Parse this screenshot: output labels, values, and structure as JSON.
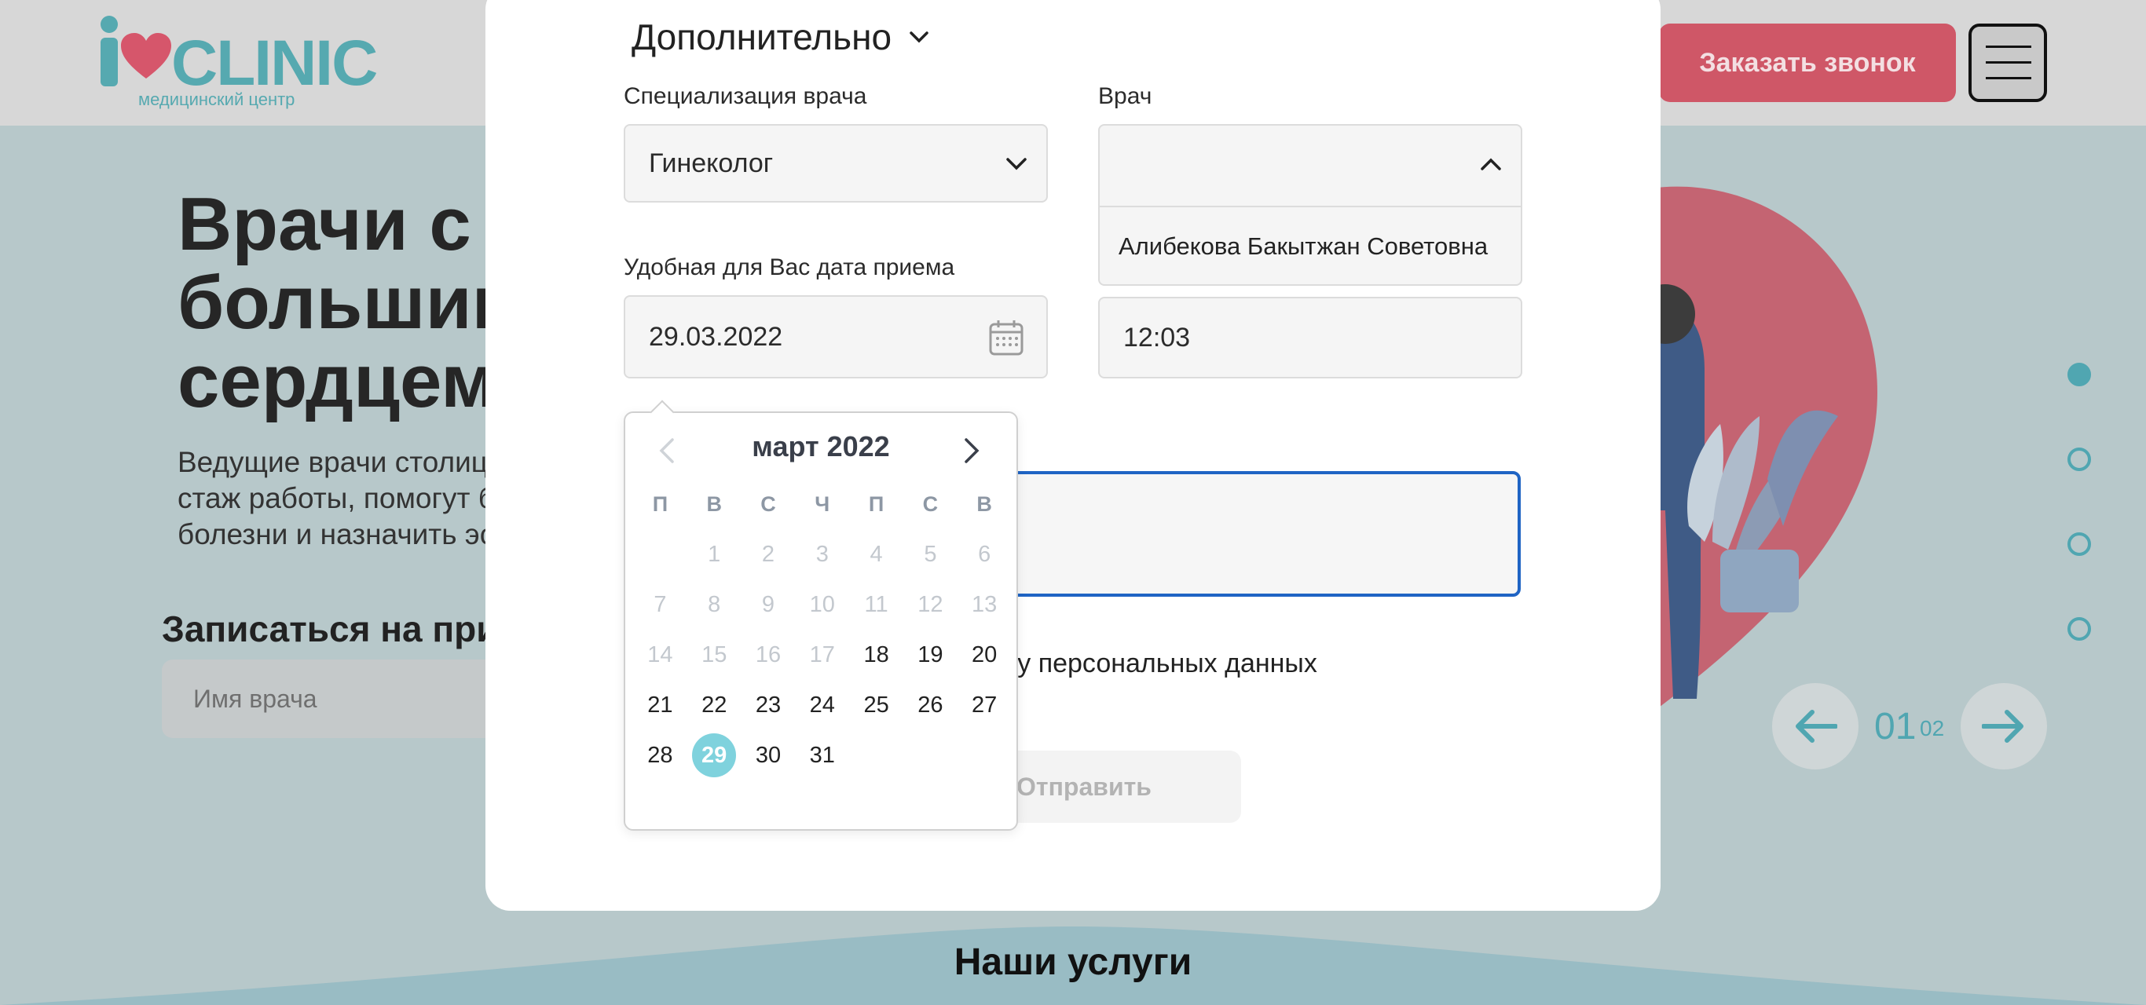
{
  "site": {
    "logo_text": "CLINIC",
    "logo_sub": "медицинский центр",
    "callback_label": "Заказать звонок",
    "hero_title": "Врачи с\nбольшим\nсердцем",
    "hero_text": "Ведущие врачи столиц\nстаж работы, помогут б\nболезни и назначить эс",
    "signup_title": "Записаться на при",
    "doctor_name_placeholder": "Имя врача",
    "slide_current": "01",
    "slide_total": "02",
    "services_title": "Наши услуги",
    "accent": "#50a6b1",
    "brand_red": "#cf5767"
  },
  "modal": {
    "section_title": "Дополнительно",
    "spec_label": "Специализация врача",
    "spec_value": "Гинеколог",
    "doctor_label": "Врач",
    "doctor_value": "",
    "doctor_option": "Алибекова Бакытжан Советовна",
    "date_label": "Удобная для Вас дата приема",
    "date_value": "29.03.2022",
    "time_value": "12:03",
    "consent_text": "ку персональных данных",
    "submit_label": "Отправить"
  },
  "calendar": {
    "title": "март 2022",
    "weekdays": [
      "П",
      "В",
      "С",
      "Ч",
      "П",
      "С",
      "В"
    ],
    "rows": [
      [
        "",
        "1",
        "2",
        "3",
        "4",
        "5",
        "6"
      ],
      [
        "7",
        "8",
        "9",
        "10",
        "11",
        "12",
        "13"
      ],
      [
        "14",
        "15",
        "16",
        "17",
        "18",
        "19",
        "20"
      ],
      [
        "21",
        "22",
        "23",
        "24",
        "25",
        "26",
        "27"
      ],
      [
        "28",
        "29",
        "30",
        "31",
        "",
        "",
        ""
      ]
    ],
    "first_enabled_day": 18,
    "selected_day": 29,
    "selected_color": "#7fd2dd"
  }
}
